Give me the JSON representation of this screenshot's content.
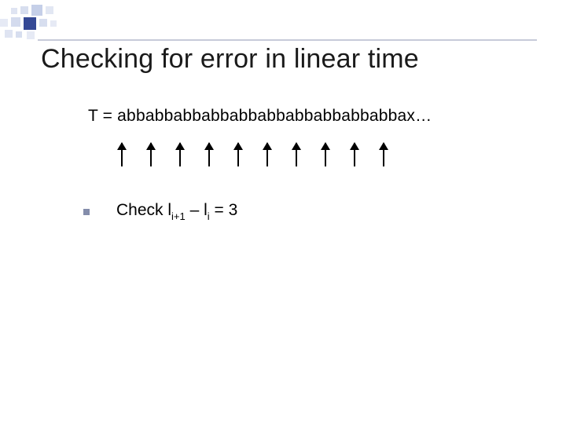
{
  "title": "Checking for error in linear time",
  "body": {
    "T_line": "T = abbabbabbabbabbabbabbabbabbabbax…",
    "arrow_count": 10,
    "check": {
      "lead": "Check l",
      "sub1": "i+1",
      "mid": " – l",
      "sub2": "i",
      "tail": " = 3"
    }
  }
}
